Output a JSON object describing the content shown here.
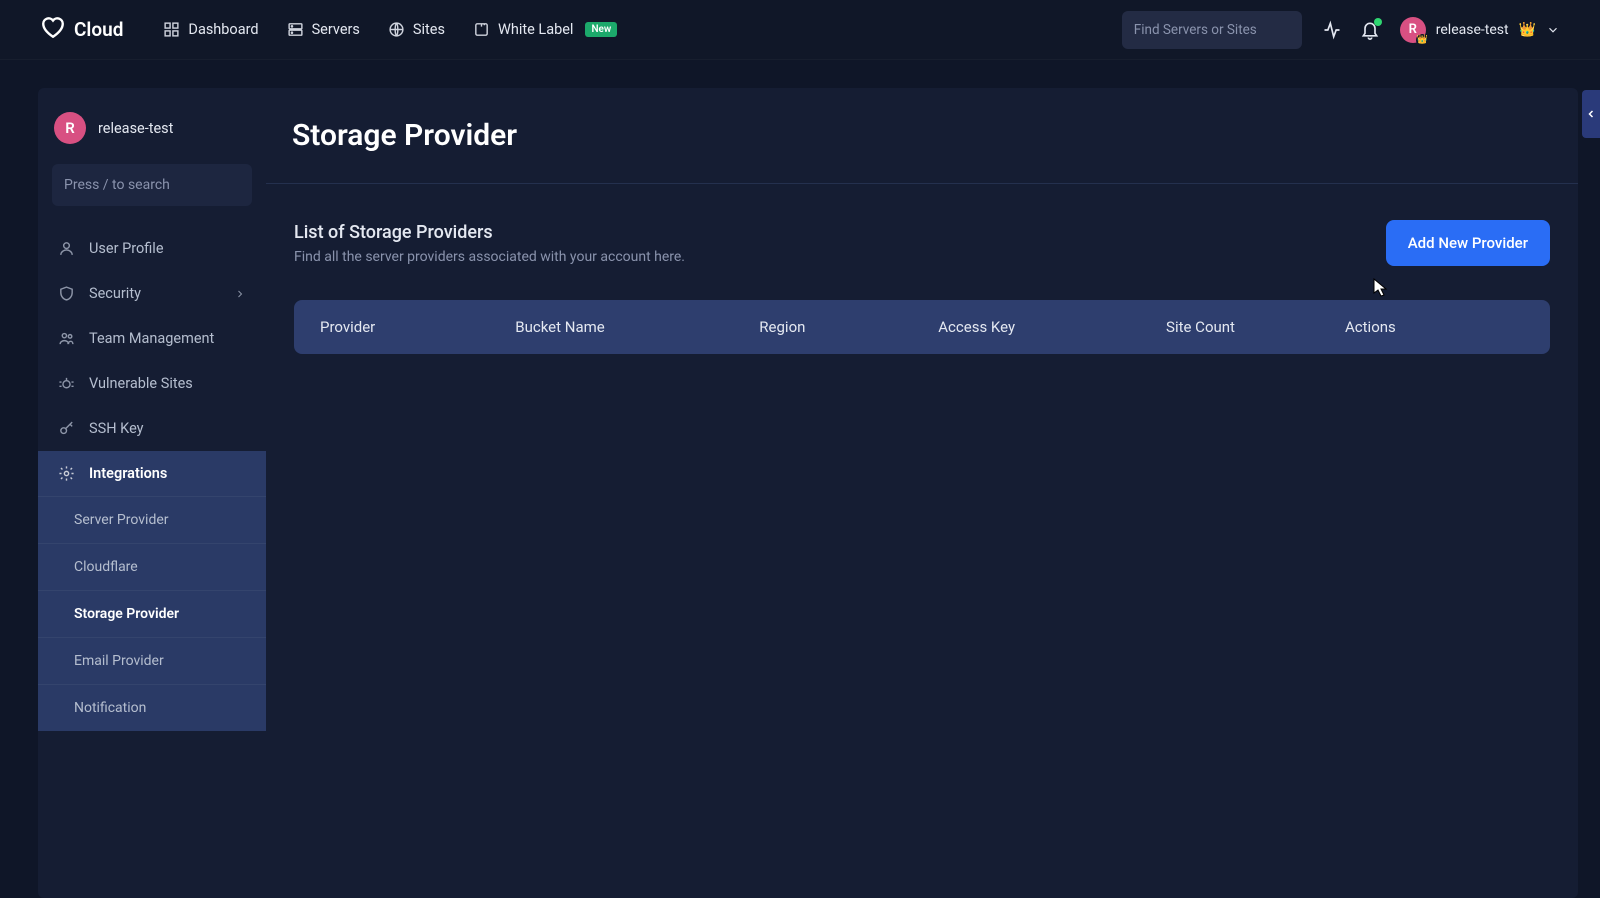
{
  "brand": "Cloud",
  "topnav": {
    "dashboard": "Dashboard",
    "servers": "Servers",
    "sites": "Sites",
    "whitelabel": "White Label",
    "new_badge": "New"
  },
  "search_placeholder": "Find Servers or Sites",
  "user": {
    "initial": "R",
    "name": "release-test"
  },
  "sidebar": {
    "search_placeholder": "Press / to search",
    "items": [
      {
        "label": "User Profile"
      },
      {
        "label": "Security"
      },
      {
        "label": "Team Management"
      },
      {
        "label": "Vulnerable Sites"
      },
      {
        "label": "SSH Key"
      },
      {
        "label": "Integrations"
      }
    ],
    "sub_items": [
      {
        "label": "Server Provider"
      },
      {
        "label": "Cloudflare"
      },
      {
        "label": "Storage Provider"
      },
      {
        "label": "Email Provider"
      },
      {
        "label": "Notification"
      }
    ]
  },
  "main": {
    "page_title": "Storage Provider",
    "section_title": "List of Storage Providers",
    "section_sub": "Find all the server providers associated with your account here.",
    "add_button": "Add New Provider",
    "columns": {
      "provider": "Provider",
      "bucket": "Bucket Name",
      "region": "Region",
      "access": "Access Key",
      "sites": "Site Count",
      "actions": "Actions"
    }
  }
}
